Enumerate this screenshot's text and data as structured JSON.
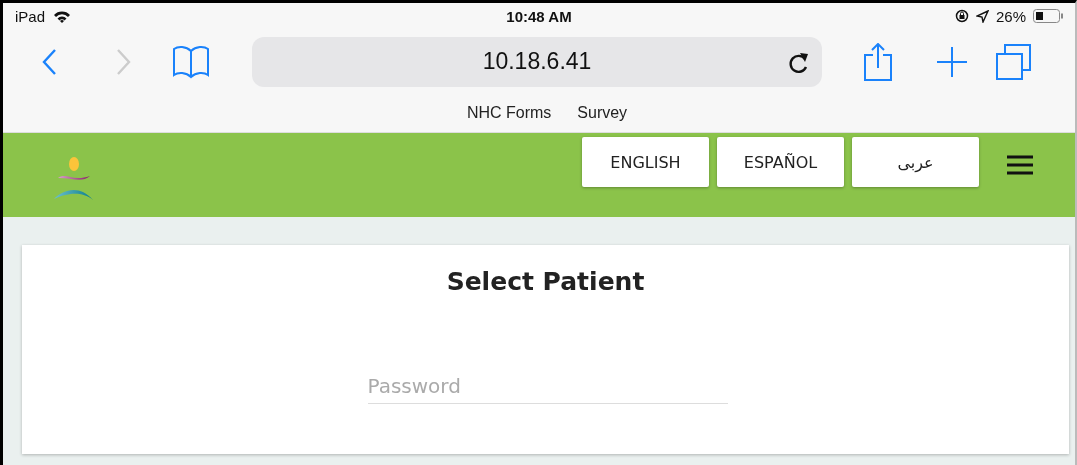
{
  "status_bar": {
    "device": "iPad",
    "time": "10:48 AM",
    "battery": "26%"
  },
  "browser": {
    "url": "10.18.6.41",
    "bookmarks": [
      "NHC Forms",
      "Survey"
    ]
  },
  "header": {
    "languages": [
      {
        "label": "ENGLISH"
      },
      {
        "label": "ESPAÑOL"
      },
      {
        "label": "عربى"
      }
    ]
  },
  "card": {
    "title": "Select Patient",
    "password": {
      "placeholder": "Password"
    }
  }
}
